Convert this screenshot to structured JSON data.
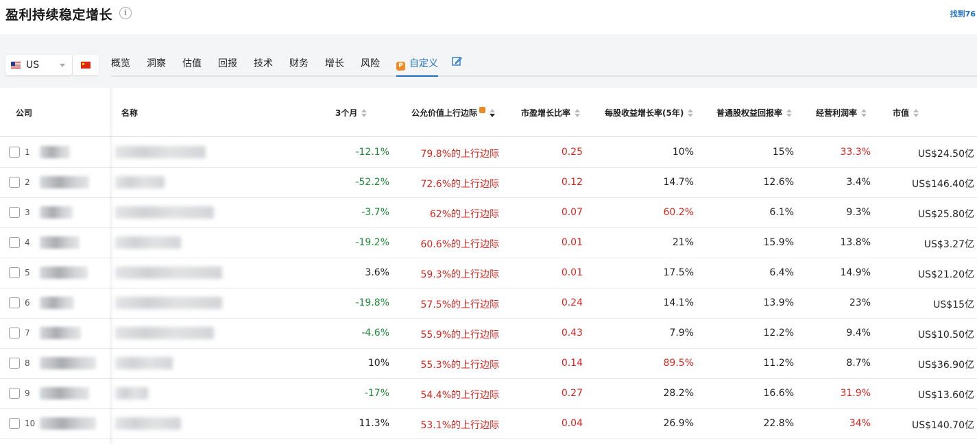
{
  "header": {
    "title": "盈利持续稳定增长",
    "found_text": "找到76"
  },
  "market": {
    "selected": "US"
  },
  "tabs": [
    "概览",
    "洞察",
    "估值",
    "回报",
    "技术",
    "财务",
    "增长",
    "风险"
  ],
  "active_tab": "自定义",
  "columns": {
    "company": "公司",
    "name": "名称",
    "m3": "3个月",
    "fv": "公允价值上行边际",
    "peg": "市盈增长比率",
    "eps": "每股收益增长率(5年)",
    "roe": "普通股权益回报率",
    "opm": "经营利润率",
    "cap": "市值"
  },
  "colors": {
    "accent": "#1f6fc0",
    "positive_red": "#d8261e",
    "negative_green": "#1e8a3a"
  },
  "rows": [
    {
      "idx": "1",
      "m3": "-12.1%",
      "fv": "79.8%的上行边际",
      "peg": "0.25",
      "eps": "10%",
      "roe": "15%",
      "opm": "33.3%",
      "cap": "US$24.50亿"
    },
    {
      "idx": "2",
      "m3": "-52.2%",
      "fv": "72.6%的上行边际",
      "peg": "0.12",
      "eps": "14.7%",
      "roe": "12.6%",
      "opm": "3.4%",
      "cap": "US$146.40亿"
    },
    {
      "idx": "3",
      "m3": "-3.7%",
      "fv": "62%的上行边际",
      "peg": "0.07",
      "eps": "60.2%",
      "roe": "6.1%",
      "opm": "9.3%",
      "cap": "US$25.80亿"
    },
    {
      "idx": "4",
      "m3": "-19.2%",
      "fv": "60.6%的上行边际",
      "peg": "0.01",
      "eps": "21%",
      "roe": "15.9%",
      "opm": "13.8%",
      "cap": "US$3.27亿"
    },
    {
      "idx": "5",
      "m3": "3.6%",
      "fv": "59.3%的上行边际",
      "peg": "0.01",
      "eps": "17.5%",
      "roe": "6.4%",
      "opm": "14.9%",
      "cap": "US$21.20亿"
    },
    {
      "idx": "6",
      "m3": "-19.8%",
      "fv": "57.5%的上行边际",
      "peg": "0.24",
      "eps": "14.1%",
      "roe": "13.9%",
      "opm": "23%",
      "cap": "US$15亿"
    },
    {
      "idx": "7",
      "m3": "-4.6%",
      "fv": "55.9%的上行边际",
      "peg": "0.43",
      "eps": "7.9%",
      "roe": "12.2%",
      "opm": "9.4%",
      "cap": "US$10.50亿"
    },
    {
      "idx": "8",
      "m3": "10%",
      "fv": "55.3%的上行边际",
      "peg": "0.14",
      "eps": "89.5%",
      "roe": "11.2%",
      "opm": "8.7%",
      "cap": "US$36.90亿"
    },
    {
      "idx": "9",
      "m3": "-17%",
      "fv": "54.4%的上行边际",
      "peg": "0.27",
      "eps": "28.2%",
      "roe": "16.6%",
      "opm": "31.9%",
      "cap": "US$13.60亿"
    },
    {
      "idx": "10",
      "m3": "11.3%",
      "fv": "53.1%的上行边际",
      "peg": "0.04",
      "eps": "26.9%",
      "roe": "22.8%",
      "opm": "34%",
      "cap": "US$140.70亿"
    }
  ]
}
